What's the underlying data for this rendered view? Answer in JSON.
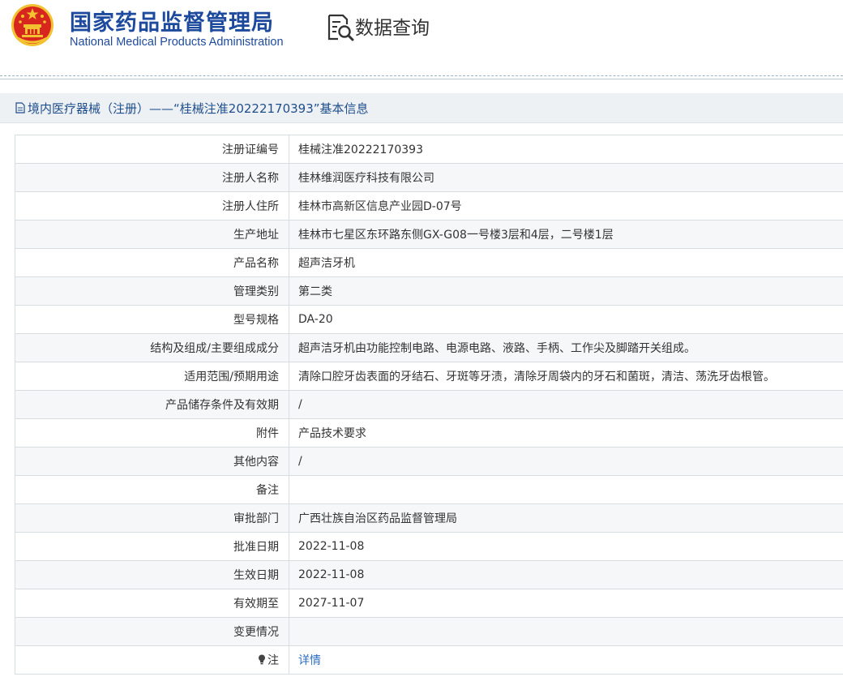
{
  "header": {
    "org_name_cn": "国家药品监督管理局",
    "org_name_en": "National Medical Products Administration",
    "query_title": "数据查询"
  },
  "page": {
    "title": "境内医疗器械（注册）——“桂械注准20222170393”基本信息"
  },
  "colors": {
    "brand_blue": "#1e4a9e",
    "emblem_red": "#d7261e",
    "link_blue": "#2b6dc2"
  },
  "rows": [
    {
      "label": "注册证编号",
      "value": "桂械注准20222170393"
    },
    {
      "label": "注册人名称",
      "value": "桂林维润医疗科技有限公司"
    },
    {
      "label": "注册人住所",
      "value": "桂林市高新区信息产业园D-07号"
    },
    {
      "label": "生产地址",
      "value": "桂林市七星区东环路东侧GX-G08一号楼3层和4层，二号楼1层"
    },
    {
      "label": "产品名称",
      "value": "超声洁牙机"
    },
    {
      "label": "管理类别",
      "value": "第二类"
    },
    {
      "label": "型号规格",
      "value": "DA-20"
    },
    {
      "label": "结构及组成/主要组成成分",
      "value": "超声洁牙机由功能控制电路、电源电路、液路、手柄、工作尖及脚踏开关组成。"
    },
    {
      "label": "适用范围/预期用途",
      "value": "清除口腔牙齿表面的牙结石、牙斑等牙渍，清除牙周袋内的牙石和菌斑，清洁、荡洗牙齿根管。"
    },
    {
      "label": "产品储存条件及有效期",
      "value": "/"
    },
    {
      "label": "附件",
      "value": "产品技术要求"
    },
    {
      "label": "其他内容",
      "value": "/"
    },
    {
      "label": "备注",
      "value": ""
    },
    {
      "label": "审批部门",
      "value": "广西壮族自治区药品监督管理局"
    },
    {
      "label": "批准日期",
      "value": "2022-11-08"
    },
    {
      "label": "生效日期",
      "value": "2022-11-08"
    },
    {
      "label": "有效期至",
      "value": "2027-11-07"
    },
    {
      "label": "变更情况",
      "value": ""
    }
  ],
  "note_row": {
    "icon": "lightbulb-icon",
    "label": "注",
    "link": "详情"
  }
}
